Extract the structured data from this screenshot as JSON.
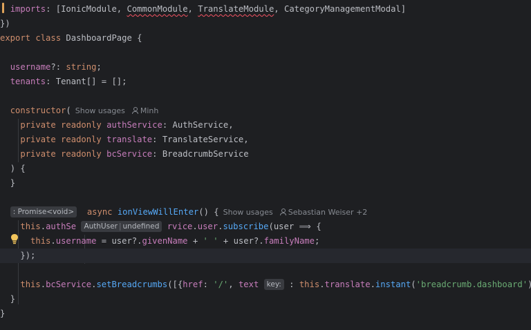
{
  "editor": {
    "lines": {
      "l1": {
        "kw": "imports",
        "pre": ": [",
        "a": "IonicModule",
        "c1": ", ",
        "b": "CommonModule",
        "c2": ", ",
        "c": "TranslateModule",
        "c3": ", ",
        "d": "CategoryManagementModal",
        "post": "]"
      },
      "l2": {
        "text": "})"
      },
      "l3": {
        "kw1": "export",
        "kw2": "class",
        "name": "DashboardPage",
        "post": " {"
      },
      "l5": {
        "prop": "username",
        "mid": "?: ",
        "ty": "string",
        "post": ";"
      },
      "l6": {
        "prop": "tenants",
        "mid": ": ",
        "ty": "Tenant",
        "post": "[] = [];"
      },
      "l8": {
        "kw": "constructor",
        "post": "(",
        "usages": "Show usages",
        "author": "Minh"
      },
      "l9": {
        "kw": "private readonly ",
        "prop": "authService",
        "mid": ": ",
        "ty": "AuthService",
        "post": ","
      },
      "l10": {
        "kw": "private readonly ",
        "prop": "translate",
        "mid": ": ",
        "ty": "TranslateService",
        "post": ","
      },
      "l11": {
        "kw": "private readonly ",
        "prop": "bcService",
        "mid": ": ",
        "ty": "BreadcrumbService"
      },
      "l12": {
        "text": ") {"
      },
      "l13": {
        "text": "}"
      },
      "l15": {
        "rettype": ": Promise<void>",
        "kw": "async",
        "fn": "ionViewWillEnter",
        "post": "() {",
        "usages": "Show usages",
        "author": "Sebastian Weiser +2"
      },
      "l16": {
        "kw": "this",
        "pre": ".",
        "prop": "authSe",
        "inlay_a": "AuthUser",
        "inlay_b": "undefined",
        "rest": "rvice",
        "dot": ".",
        "p2": "user",
        "dot2": ".",
        "fn": "subscribe",
        "post": "(user ⟹ {"
      },
      "l17": {
        "kw": "this",
        "pre": ".",
        "prop": "username",
        "mid": " = user?.",
        "p2": "givenName",
        "mid2": " + ",
        "str": "' '",
        "mid3": " + user?.",
        "p3": "familyName",
        "post": ";"
      },
      "l18": {
        "text": "});"
      },
      "l20": {
        "kw": "this",
        "pre": ".",
        "prop": "bcService",
        "dot": ".",
        "fn": "setBreadcrumbs",
        "open": "([{",
        "p1": "href",
        "c1": ": ",
        "s1": "'/'",
        "c2": ", ",
        "p2": "text",
        "inlay": "key:",
        "c3": " : ",
        "kw2": "this",
        "d2": ".",
        "p3": "translate",
        "d3": ".",
        "fn2": "instant",
        "o2": "(",
        "s2": "'breadcrumb.dashboard'",
        "post": ")}]);"
      },
      "l21": {
        "text": "}"
      },
      "l22": {
        "text": "}"
      }
    },
    "colors": {
      "background": "#1e1f22",
      "keyword": "#cf8e6d",
      "function": "#56a8f5",
      "property": "#c77dbb",
      "string": "#6aab73",
      "text": "#bcbec4"
    }
  }
}
